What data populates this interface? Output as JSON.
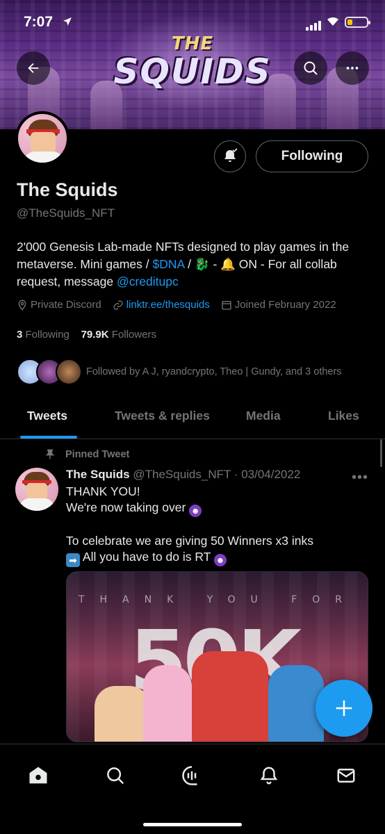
{
  "status_bar": {
    "time": "7:07"
  },
  "banner": {
    "title_top": "THE",
    "title_main": "SQUIDS"
  },
  "profile": {
    "name": "The Squids",
    "handle": "@TheSquids_NFT",
    "bio_text_1": "2'000 Genesis Lab-made NFTs designed to play games in the metaverse. Mini games / ",
    "bio_link_1": "$DNA",
    "bio_text_2": " / 🐉 - 🔔 ON - For all collab request, message ",
    "bio_link_2": "@creditupc",
    "location": "Private Discord",
    "website": "linktr.ee/thesquids",
    "joined": "Joined February 2022",
    "following_count": "3",
    "following_label": "Following",
    "followers_count": "79.9K",
    "followers_label": "Followers",
    "followed_by": "Followed by A J, ryandcrypto, Theo | Gundy, and 3 others",
    "follow_button": "Following"
  },
  "tabs": [
    {
      "label": "Tweets",
      "active": true
    },
    {
      "label": "Tweets & replies",
      "active": false
    },
    {
      "label": "Media",
      "active": false
    },
    {
      "label": "Likes",
      "active": false
    }
  ],
  "tweet": {
    "pinned_label": "Pinned Tweet",
    "author_name": "The Squids",
    "author_handle": "@TheSquids_NFT · 03/04/2022",
    "more": "•••",
    "line1": "THANK YOU!",
    "line2": "We're now taking over ",
    "line3": "To celebrate we are giving 50 Winners x3 inks",
    "line4": " All you have to do is RT ",
    "media_caption": "THANK YOU FOR",
    "media_big": "50K"
  },
  "colors": {
    "accent": "#1d9bf0",
    "muted": "#71767b",
    "text": "#e7e9ea",
    "background": "#000000"
  },
  "icons": [
    "back-arrow-icon",
    "search-icon",
    "more-icon",
    "notification-bell-icon",
    "location-icon",
    "link-icon",
    "calendar-icon",
    "pin-icon",
    "compose-plus-icon",
    "home-icon",
    "explore-icon",
    "spaces-icon",
    "notifications-icon",
    "messages-icon"
  ]
}
